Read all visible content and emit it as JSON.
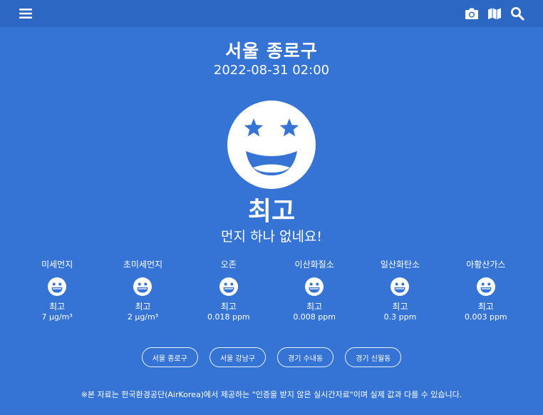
{
  "header": {
    "icons": [
      "menu-icon",
      "camera-icon",
      "map-icon",
      "search-icon"
    ]
  },
  "location": {
    "name": "서울 종로구",
    "timestamp": "2022-08-31 02:00"
  },
  "overall": {
    "grade": "최고",
    "message": "먼지 하나 없네요!",
    "face_icon": "star-eyes-grin-icon"
  },
  "metrics": [
    {
      "name": "미세먼지",
      "grade": "최고",
      "value": "7 μg/m³",
      "face_icon": "grin-icon"
    },
    {
      "name": "초미세먼지",
      "grade": "최고",
      "value": "2 μg/m³",
      "face_icon": "grin-icon"
    },
    {
      "name": "오존",
      "grade": "최고",
      "value": "0.018 ppm",
      "face_icon": "grin-icon"
    },
    {
      "name": "이산화질소",
      "grade": "최고",
      "value": "0.008 ppm",
      "face_icon": "grin-icon"
    },
    {
      "name": "일산화탄소",
      "grade": "최고",
      "value": "0.3 ppm",
      "face_icon": "grin-icon"
    },
    {
      "name": "아황산가스",
      "grade": "최고",
      "value": "0.003 ppm",
      "face_icon": "grin-icon"
    }
  ],
  "region_buttons": [
    "서울 종로구",
    "서울 강남구",
    "경기 수내동",
    "경기 신월동"
  ],
  "footnote": "※본 자료는 한국환경공단(AirKorea)에서 제공하는 \"인증을 받지 않은 실시간자료\"이며 실제 값과 다를 수 있습니다.",
  "colors": {
    "background": "#3574D4",
    "topbar": "#2C67C4",
    "foreground": "#FFFFFF"
  }
}
